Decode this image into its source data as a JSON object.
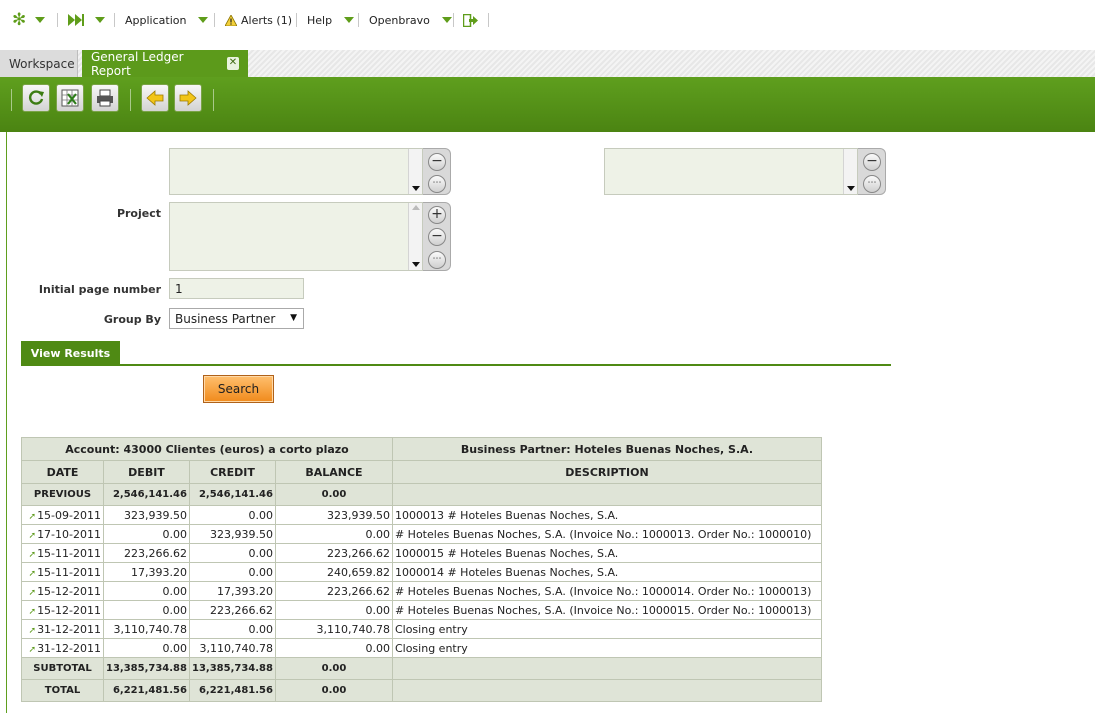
{
  "navbar": {
    "application": "Application",
    "alerts": "Alerts (1)",
    "help": "Help",
    "openbravo": "Openbravo"
  },
  "tabs": {
    "workspace": "Workspace",
    "report": "General Ledger Report",
    "close": "✕"
  },
  "form": {
    "project_label": "Project",
    "initial_page_label": "Initial page number",
    "initial_page_value": "1",
    "group_by_label": "Group By",
    "group_by_value": "Business Partner",
    "view_results": "View Results",
    "search": "Search"
  },
  "report": {
    "account_header": "Account: 43000 Clientes (euros) a corto plazo",
    "partner_header": "Business Partner:  Hoteles Buenas Noches, S.A.",
    "columns": [
      "DATE",
      "DEBIT",
      "CREDIT",
      "BALANCE",
      "DESCRIPTION"
    ],
    "previous": {
      "label": "PREVIOUS",
      "debit": "2,546,141.46",
      "credit": "2,546,141.46",
      "balance": "0.00"
    },
    "rows": [
      {
        "date": "15-09-2011",
        "debit": "323,939.50",
        "credit": "0.00",
        "balance": "323,939.50",
        "desc": "1000013 # Hoteles Buenas Noches, S.A."
      },
      {
        "date": "17-10-2011",
        "debit": "0.00",
        "credit": "323,939.50",
        "balance": "0.00",
        "desc": "# Hoteles Buenas Noches, S.A. (Invoice No.: 1000013. Order No.: 1000010)"
      },
      {
        "date": "15-11-2011",
        "debit": "223,266.62",
        "credit": "0.00",
        "balance": "223,266.62",
        "desc": "1000015 # Hoteles Buenas Noches, S.A."
      },
      {
        "date": "15-11-2011",
        "debit": "17,393.20",
        "credit": "0.00",
        "balance": "240,659.82",
        "desc": "1000014 # Hoteles Buenas Noches, S.A."
      },
      {
        "date": "15-12-2011",
        "debit": "0.00",
        "credit": "17,393.20",
        "balance": "223,266.62",
        "desc": "# Hoteles Buenas Noches, S.A. (Invoice No.: 1000014. Order No.: 1000013)"
      },
      {
        "date": "15-12-2011",
        "debit": "0.00",
        "credit": "223,266.62",
        "balance": "0.00",
        "desc": "# Hoteles Buenas Noches, S.A. (Invoice No.: 1000015. Order No.: 1000013)"
      },
      {
        "date": "31-12-2011",
        "debit": "3,110,740.78",
        "credit": "0.00",
        "balance": "3,110,740.78",
        "desc": "Closing entry"
      },
      {
        "date": "31-12-2011",
        "debit": "0.00",
        "credit": "3,110,740.78",
        "balance": "0.00",
        "desc": "Closing entry"
      }
    ],
    "subtotal": {
      "label": "SUBTOTAL",
      "debit": "13,385,734.88",
      "credit": "13,385,734.88",
      "balance": "0.00"
    },
    "total": {
      "label": "TOTAL",
      "debit": "6,221,481.56",
      "credit": "6,221,481.56",
      "balance": "0.00"
    }
  },
  "colors": {
    "accent_green": "#5c9a1b",
    "search_orange": "#f08a1b"
  }
}
